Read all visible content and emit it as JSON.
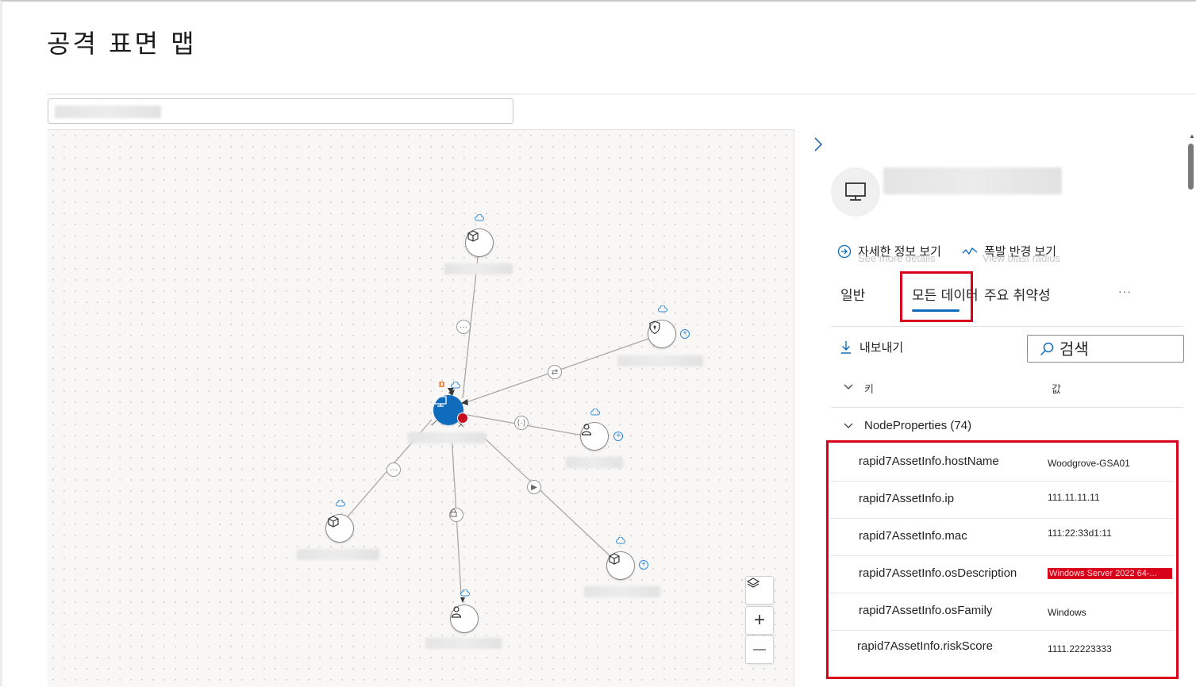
{
  "page": {
    "title": "공격 표면 맵"
  },
  "map_controls": {
    "layers_icon": "layers-icon",
    "zoom_in_symbol": "+",
    "zoom_out_symbol": "—"
  },
  "graph": {
    "edge_icons": [
      "ellipsis",
      "swap-arrows",
      "link",
      "ellipsis",
      "lock",
      "play"
    ],
    "node_icons": [
      "cube-icon",
      "shield-icon",
      "person-icon",
      "cube-icon",
      "person-icon",
      "cube-icon",
      "monitor-icon"
    ]
  },
  "panel": {
    "actions": [
      {
        "label": "자세한 정보 보기",
        "ghost": "See more details",
        "icon": "arrow-circle-icon"
      },
      {
        "label": "폭발 반경 보기",
        "ghost": "View blast radius",
        "icon": "pulse-icon"
      }
    ],
    "tabs": [
      {
        "label": "일반"
      },
      {
        "label": "모든 데이터"
      },
      {
        "label": "주요 취약성"
      }
    ],
    "more_label": "···",
    "export_label": "내보내기",
    "search_placeholder": "검색",
    "columns": {
      "key": "키",
      "value": "값"
    },
    "group_label": "NodeProperties (74)",
    "rows": [
      {
        "key": "rapid7AssetInfo.hostName",
        "value": "Woodgrove-GSA01"
      },
      {
        "key": "rapid7AssetInfo.ip",
        "value": "111.11.11.11"
      },
      {
        "key": "rapid7AssetInfo.mac",
        "value": "111:22:33d1:11"
      },
      {
        "key": "rapid7AssetInfo.osDescription",
        "value": "Windows Server 2022 64-..."
      },
      {
        "key": "rapid7AssetInfo.osFamily",
        "value": "Windows"
      },
      {
        "key": "rapid7AssetInfo.riskScore",
        "value": "1111.22223333"
      }
    ]
  },
  "colors": {
    "accent": "#0f6cbd",
    "highlight": "#d9001b"
  }
}
